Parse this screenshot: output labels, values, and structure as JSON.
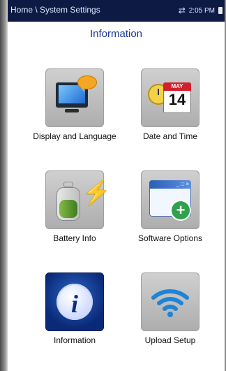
{
  "status_bar": {
    "breadcrumb": "Home \\ System Settings",
    "time": "2:05 PM",
    "icons": [
      "sync-icon",
      "battery-icon"
    ]
  },
  "page": {
    "title": "Information"
  },
  "tiles": [
    {
      "id": "display-language",
      "label": "Display and Language",
      "icon": "monitor-chat-icon"
    },
    {
      "id": "date-time",
      "label": "Date and Time",
      "icon": "clock-calendar-icon",
      "calendar_month": "MAY",
      "calendar_day": "14"
    },
    {
      "id": "battery-info",
      "label": "Battery Info",
      "icon": "battery-bolt-icon"
    },
    {
      "id": "software-options",
      "label": "Software Options",
      "icon": "window-plus-icon"
    },
    {
      "id": "information",
      "label": "Information",
      "icon": "info-icon",
      "info_glyph": "i",
      "selected": true
    },
    {
      "id": "upload-setup",
      "label": "Upload Setup",
      "icon": "wifi-icon"
    }
  ],
  "colors": {
    "status_bar_bg": "#0d1b44",
    "title": "#1a3a96",
    "selected_tile": "#0a2a78"
  }
}
